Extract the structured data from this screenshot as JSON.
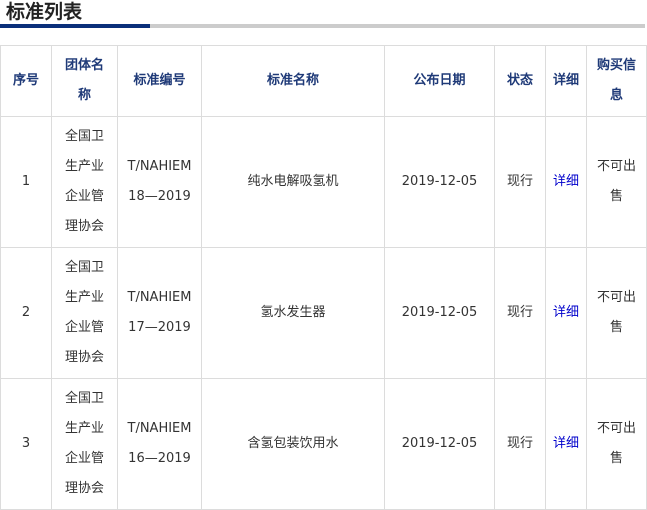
{
  "heading": "标准列表",
  "accent_color": "#0a2f7a",
  "columns": [
    "序号",
    "团体名称",
    "标准编号",
    "标准名称",
    "公布日期",
    "状态",
    "详细",
    "购买信息"
  ],
  "rows": [
    {
      "index": "1",
      "org": "全国卫生产业企业管理协会",
      "code": "T/NAHIEM 18—2019",
      "name": "纯水电解吸氢机",
      "date": "2019-12-05",
      "status": "现行",
      "detail": "详细",
      "buy": "不可出售"
    },
    {
      "index": "2",
      "org": "全国卫生产业企业管理协会",
      "code": "T/NAHIEM 17—2019",
      "name": "氢水发生器",
      "date": "2019-12-05",
      "status": "现行",
      "detail": "详细",
      "buy": "不可出售"
    },
    {
      "index": "3",
      "org": "全国卫生产业企业管理协会",
      "code": "T/NAHIEM 16—2019",
      "name": "含氢包装饮用水",
      "date": "2019-12-05",
      "status": "现行",
      "detail": "详细",
      "buy": "不可出售"
    }
  ]
}
